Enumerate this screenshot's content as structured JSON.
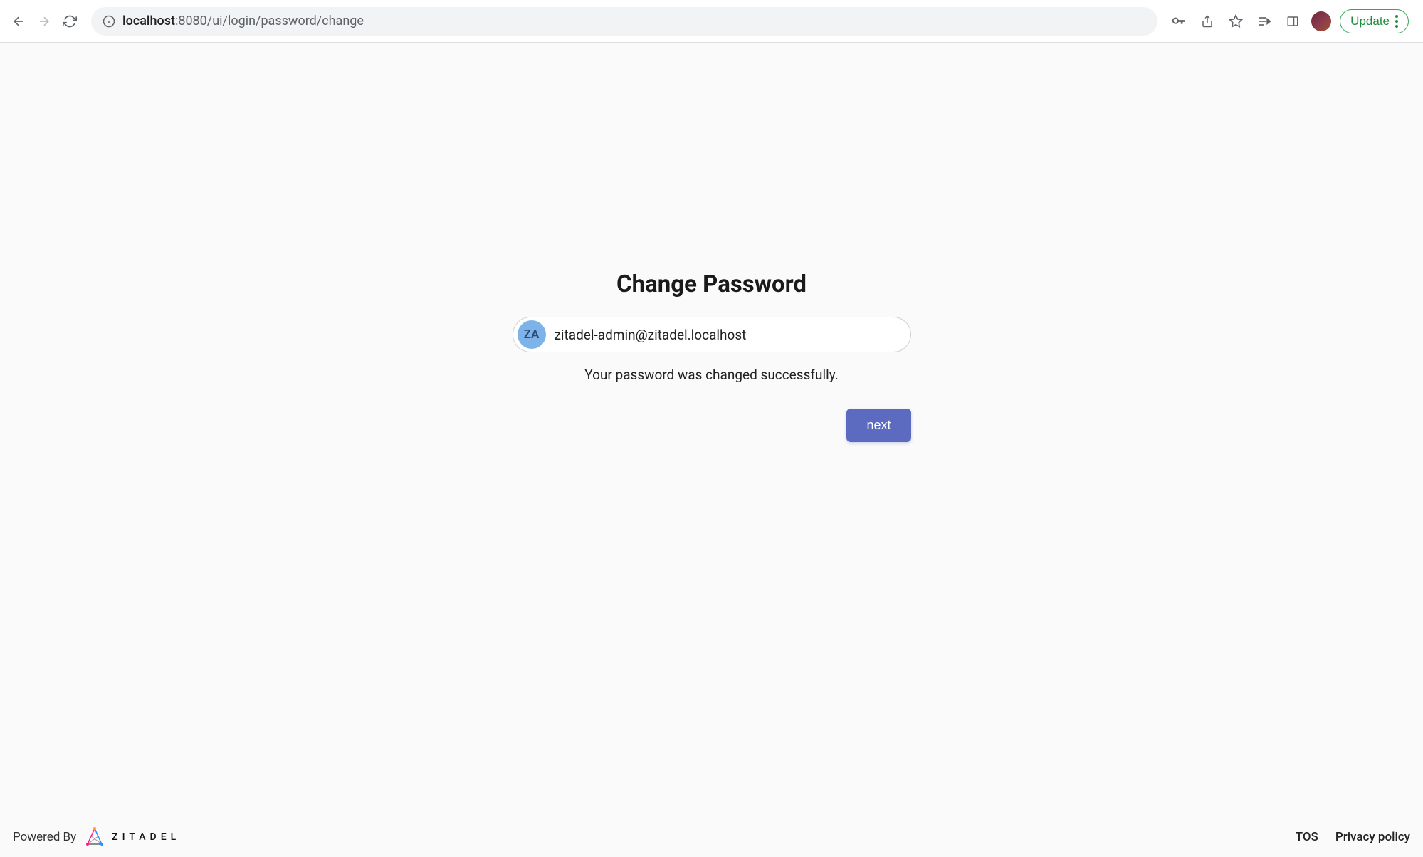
{
  "browser": {
    "url_host": "localhost",
    "url_path": ":8080/ui/login/password/change",
    "update_label": "Update"
  },
  "header": {
    "title": "Change Password"
  },
  "user": {
    "initials": "ZA",
    "email": "zitadel-admin@zitadel.localhost"
  },
  "message": "Your password was changed successfully.",
  "actions": {
    "next_label": "next"
  },
  "footer": {
    "powered_by": "Powered By",
    "brand": "ZITADEL",
    "tos": "TOS",
    "privacy": "Privacy policy"
  }
}
